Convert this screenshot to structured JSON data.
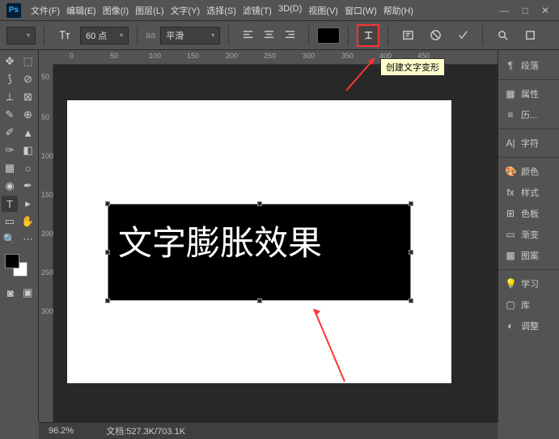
{
  "app": {
    "logo": "Ps"
  },
  "menu": [
    "文件(F)",
    "编辑(E)",
    "图像(I)",
    "图层(L)",
    "文字(Y)",
    "选择(S)",
    "滤镜(T)",
    "3D(D)",
    "视图(V)",
    "窗口(W)",
    "帮助(H)"
  ],
  "window_controls": {
    "min": "—",
    "max": "□",
    "close": "✕"
  },
  "options": {
    "font_size": "60 点",
    "aa_icon": "aa",
    "antialiasing": "平滑",
    "warp_tooltip": "创建文字变形"
  },
  "ruler_h": [
    "0",
    "50",
    "100",
    "150",
    "200",
    "250",
    "300",
    "350",
    "400",
    "450"
  ],
  "ruler_v": [
    "50",
    "50",
    "100",
    "150",
    "200",
    "250",
    "300"
  ],
  "canvas_text": "文字膨胀效果",
  "status": {
    "zoom": "96.2%",
    "docinfo": "文档:527.3K/703.1K"
  },
  "panels": [
    {
      "icon": "¶",
      "label": "段落"
    },
    {
      "icon": "▦",
      "label": "属性"
    },
    {
      "icon": "≡",
      "label": "历..."
    },
    {
      "icon": "A|",
      "label": "字符"
    },
    {
      "icon": "🎨",
      "label": "颜色"
    },
    {
      "icon": "fx",
      "label": "样式"
    },
    {
      "icon": "⊞",
      "label": "色板"
    },
    {
      "icon": "▭",
      "label": "渐变"
    },
    {
      "icon": "▩",
      "label": "图案"
    },
    {
      "icon": "💡",
      "label": "学习"
    },
    {
      "icon": "▢",
      "label": "库"
    },
    {
      "icon": "◐",
      "label": "调整"
    }
  ],
  "chart_data": null
}
